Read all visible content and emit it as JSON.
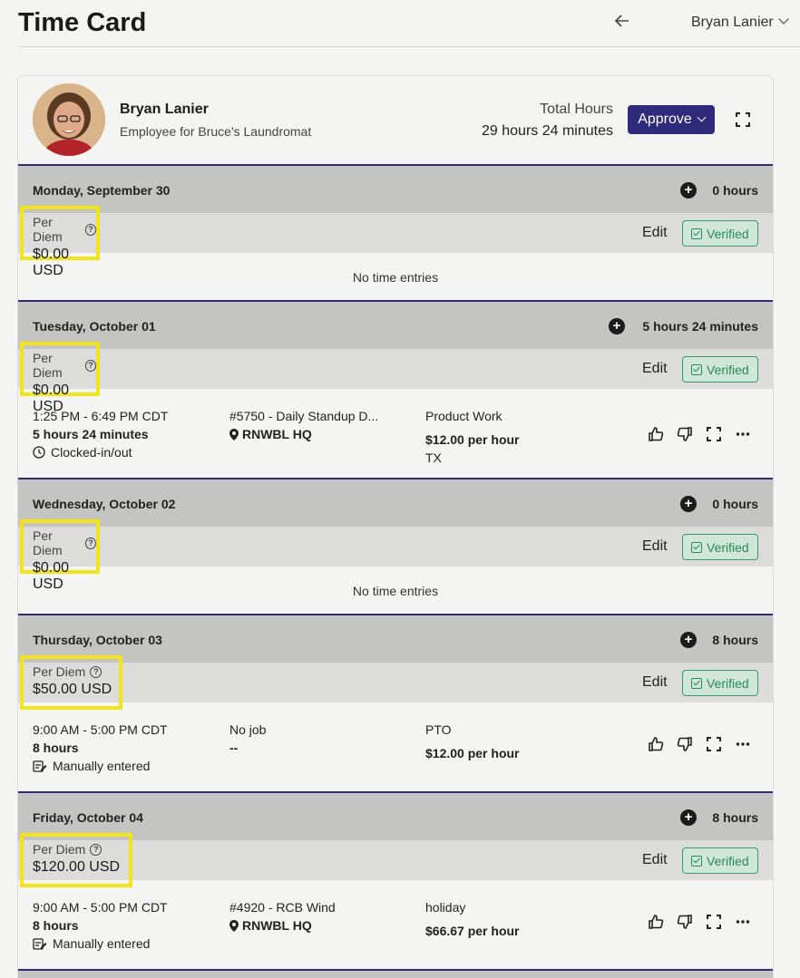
{
  "header": {
    "title": "Time Card",
    "user_menu": "Bryan Lanier"
  },
  "employee": {
    "name": "Bryan Lanier",
    "subtitle": "Employee for Bruce's Laundromat",
    "total_hours_label": "Total Hours",
    "total_hours_value": "29 hours 24 minutes",
    "approve_label": "Approve"
  },
  "common": {
    "per_diem_label": "Per Diem",
    "edit_label": "Edit",
    "verified_label": "Verified",
    "no_entries": "No time entries"
  },
  "days": [
    {
      "name": "Monday, September 30",
      "hours": "0 hours",
      "per_diem": "$0.00 USD"
    },
    {
      "name": "Tuesday, October 01",
      "hours": "5 hours 24 minutes",
      "per_diem": "$0.00 USD",
      "entry": {
        "time": "1:25 PM - 6:49 PM CDT",
        "duration": "5 hours 24 minutes",
        "method": "Clocked-in/out",
        "job": "#5750 - Daily Standup D...",
        "location": "RNWBL HQ",
        "category": "Product Work",
        "rate": "$12.00 per hour",
        "extra": "TX"
      }
    },
    {
      "name": "Wednesday, October 02",
      "hours": "0 hours",
      "per_diem": "$0.00 USD"
    },
    {
      "name": "Thursday, October 03",
      "hours": "8 hours",
      "per_diem": "$50.00 USD",
      "entry": {
        "time": "9:00 AM - 5:00 PM CDT",
        "duration": "8 hours",
        "method": "Manually entered",
        "job": "No job",
        "location": "--",
        "category": "PTO",
        "rate": "$12.00 per hour"
      }
    },
    {
      "name": "Friday, October 04",
      "hours": "8 hours",
      "per_diem": "$120.00 USD",
      "entry": {
        "time": "9:00 AM - 5:00 PM CDT",
        "duration": "8 hours",
        "method": "Manually entered",
        "job": "#4920 - RCB Wind",
        "location": "RNWBL HQ",
        "category": "holiday",
        "rate": "$66.67 per hour"
      }
    }
  ]
}
